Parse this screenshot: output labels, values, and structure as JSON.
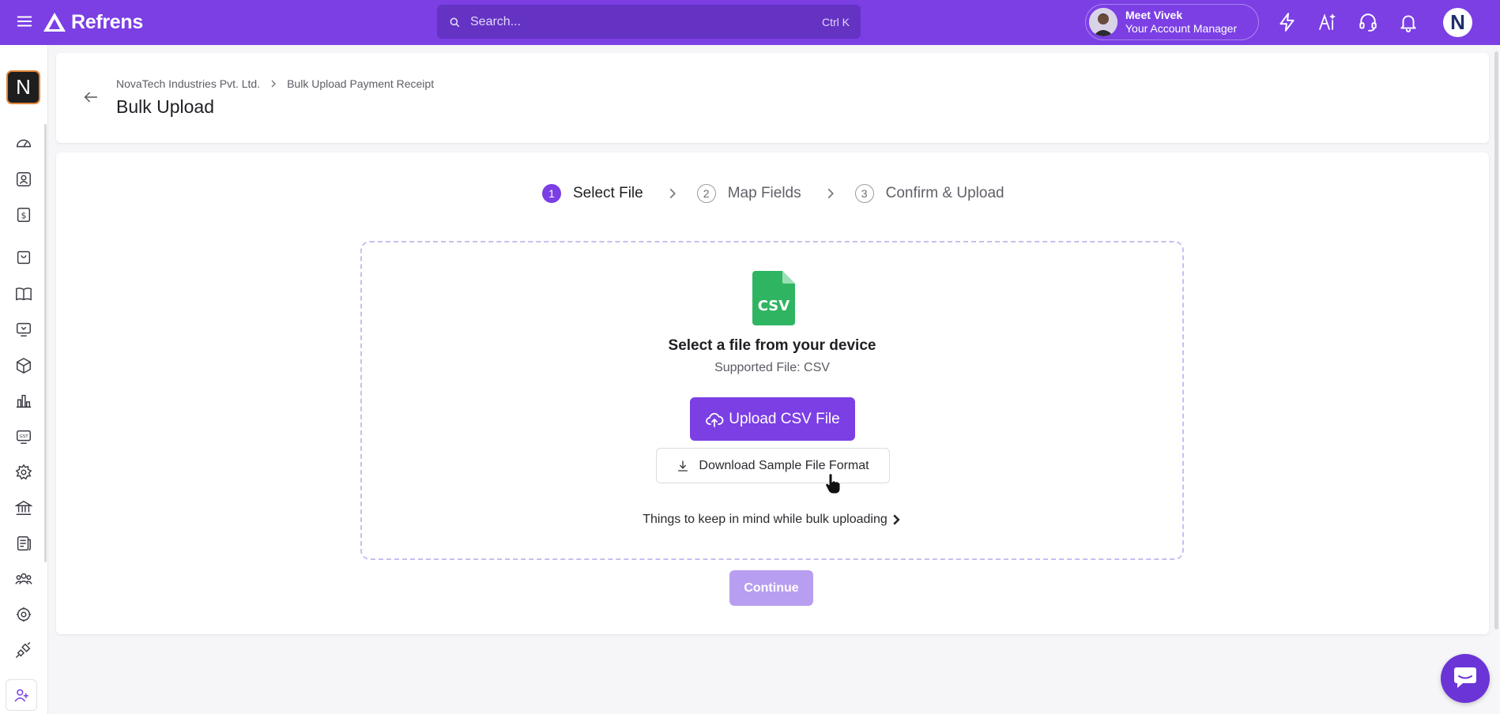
{
  "topbar": {
    "brand": "Refrens",
    "search_placeholder": "Search...",
    "search_shortcut": "Ctrl K",
    "account_manager_title": "Meet Vivek",
    "account_manager_subtitle": "Your Account Manager",
    "user_initial": "N",
    "brand_color": "#7b3fe4"
  },
  "sidebar": {
    "org_initial": "N",
    "icons": [
      "dashboard-icon",
      "contacts-icon",
      "dollar-icon",
      "bag-icon",
      "book-icon",
      "monitor-icon",
      "box-icon",
      "chart-icon",
      "gst-icon",
      "settings-users-icon",
      "bank-icon",
      "document-icon",
      "team-icon",
      "gear-icon",
      "integration-icon"
    ]
  },
  "header": {
    "breadcrumb": [
      "NovaTech Industries Pvt. Ltd.",
      "Bulk Upload Payment Receipt"
    ],
    "title": "Bulk Upload"
  },
  "stepper": {
    "steps": [
      {
        "num": "1",
        "label": "Select File",
        "active": true
      },
      {
        "num": "2",
        "label": "Map Fields",
        "active": false
      },
      {
        "num": "3",
        "label": "Confirm & Upload",
        "active": false
      }
    ]
  },
  "dropzone": {
    "title": "Select a file from your device",
    "subtitle": "Supported File: CSV",
    "upload_label": "Upload CSV File",
    "sample_label": "Download Sample File Format",
    "tips_label": "Things to keep in mind while bulk uploading",
    "csv_badge": "CSV"
  },
  "actions": {
    "continue_label": "Continue"
  }
}
